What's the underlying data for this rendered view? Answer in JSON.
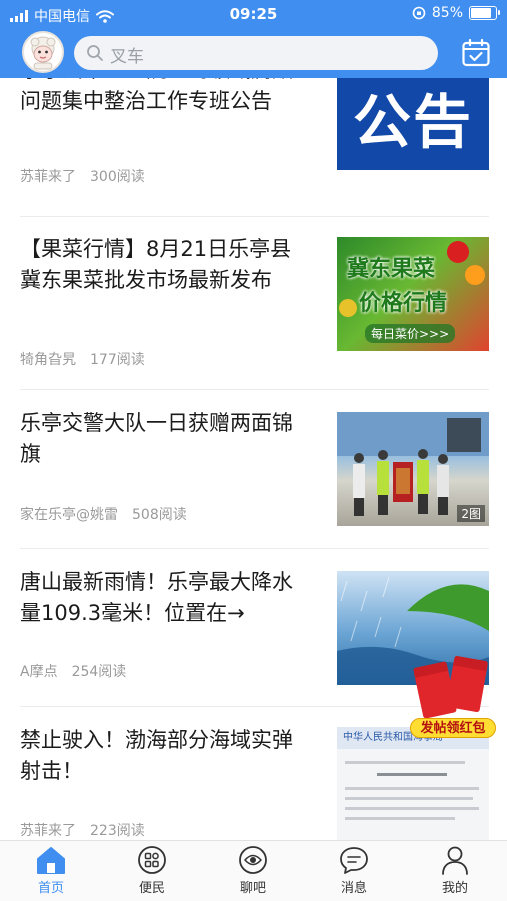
{
  "status_bar": {
    "carrier": "中国电信",
    "time": "09:25",
    "battery": "85%",
    "battery_level": 0.85
  },
  "search": {
    "placeholder": "叉车"
  },
  "feed": [
    {
      "title": "乐亭县中医医院医药领域腐败问题集中整治工作专班公告",
      "author": "苏菲来了",
      "views": "300阅读",
      "thumb_text": "公告"
    },
    {
      "title": "【果菜行情】8月21日乐亭县冀东果菜批发市场最新发布",
      "author": "犄角旮旯",
      "views": "177阅读",
      "thumb_line1": "冀东果菜",
      "thumb_line2": "价格行情",
      "thumb_line3": "每日菜价>>>"
    },
    {
      "title": "乐亭交警大队一日获赠两面锦旗",
      "author": "家在乐亭@姚雷",
      "views": "508阅读",
      "image_count": "2图"
    },
    {
      "title": "唐山最新雨情！乐亭最大降水量109.3毫米！位置在→",
      "author": "A摩点",
      "views": "254阅读"
    },
    {
      "title": "禁止驶入！渤海部分海域实弹射击！",
      "author": "苏菲来了",
      "views": "223阅读",
      "doc_header": "中华人民共和国海事局"
    }
  ],
  "red_packet": {
    "label": "发帖领红包"
  },
  "tabs": [
    {
      "label": "首页",
      "icon": "home-icon",
      "active": true
    },
    {
      "label": "便民",
      "icon": "grid-icon",
      "active": false
    },
    {
      "label": "聊吧",
      "icon": "chat-bubble-eye-icon",
      "active": false
    },
    {
      "label": "消息",
      "icon": "message-icon",
      "active": false
    },
    {
      "label": "我的",
      "icon": "person-icon",
      "active": false
    }
  ],
  "colors": {
    "primary": "#3f8ef0",
    "tab_active": "#3f8ef0",
    "meta_text": "#9a9a9a",
    "announce_bg": "#1248a8"
  }
}
